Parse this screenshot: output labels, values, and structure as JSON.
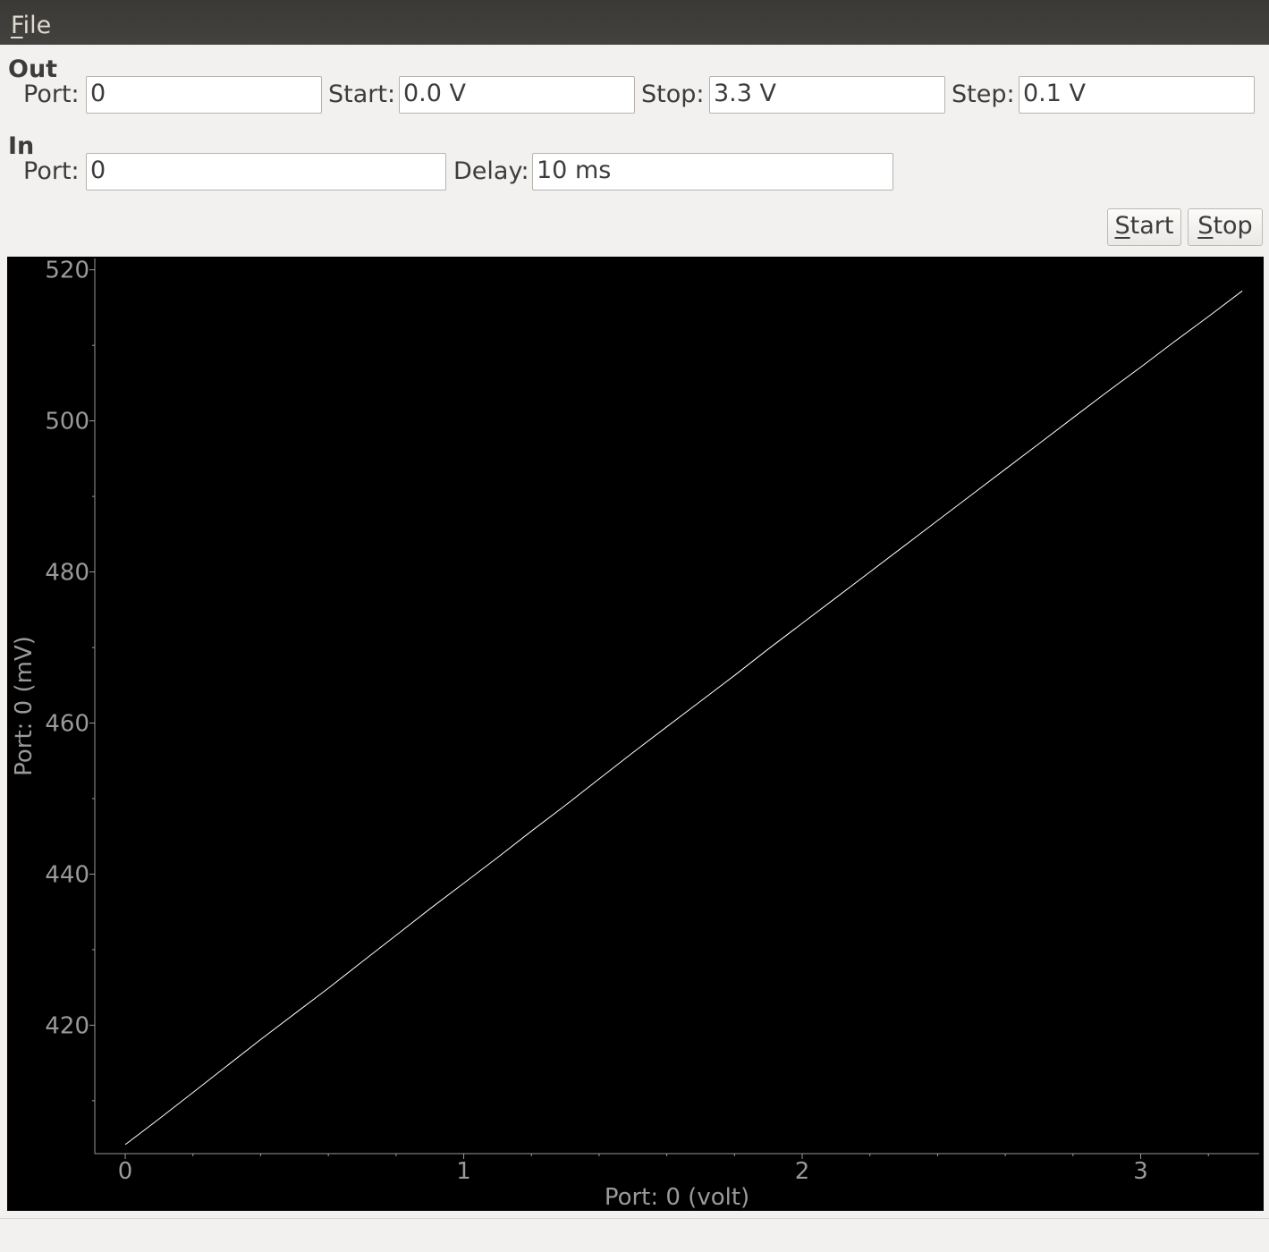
{
  "menu": {
    "file_label_mnemonic": "F",
    "file_label_rest": "ile"
  },
  "out": {
    "title": "Out",
    "port_label": "Port:",
    "port_value": "0",
    "start_label": "Start:",
    "start_value": "0.0 V",
    "stop_label": "Stop:",
    "stop_value": "3.3 V",
    "step_label": "Step:",
    "step_value": "0.1 V"
  },
  "in": {
    "title": "In",
    "port_label": "Port:",
    "port_value": "0",
    "delay_label": "Delay:",
    "delay_value": "10 ms"
  },
  "buttons": {
    "start_mnemonic": "S",
    "start_rest": "tart",
    "stop_mnemonic": "S",
    "stop_rest": "top"
  },
  "chart_data": {
    "type": "line",
    "xlabel": "Port: 0 (volt)",
    "ylabel": "Port: 0 (mV)",
    "xlim": [
      -0.09,
      3.35
    ],
    "ylim": [
      403,
      521.5
    ],
    "x_ticks": [
      0,
      1,
      2,
      3
    ],
    "y_ticks": [
      420,
      440,
      460,
      480,
      500,
      520
    ],
    "grid": false,
    "background": "#000000",
    "line_color": "#ffffff",
    "axis_color": "#9a9a9a",
    "series": [
      {
        "x": [
          0.0,
          0.1,
          0.2,
          0.3,
          0.4,
          0.5,
          0.6,
          0.7,
          0.8,
          0.9,
          1.0,
          1.1,
          1.2,
          1.3,
          1.4,
          1.5,
          1.6,
          1.7,
          1.8,
          1.9,
          2.0,
          2.1,
          2.2,
          2.3,
          2.4,
          2.5,
          2.6,
          2.7,
          2.8,
          2.9,
          3.0,
          3.1,
          3.2,
          3.3
        ],
        "y": [
          404.2,
          407.6,
          411.1,
          414.6,
          418.1,
          421.5,
          424.9,
          428.4,
          431.9,
          435.4,
          438.8,
          442.2,
          445.7,
          449.1,
          452.6,
          456.1,
          459.5,
          462.9,
          466.3,
          469.8,
          473.2,
          476.6,
          480.0,
          483.4,
          486.8,
          490.2,
          493.6,
          497.0,
          500.4,
          503.8,
          507.1,
          510.5,
          513.8,
          517.2
        ]
      }
    ]
  }
}
